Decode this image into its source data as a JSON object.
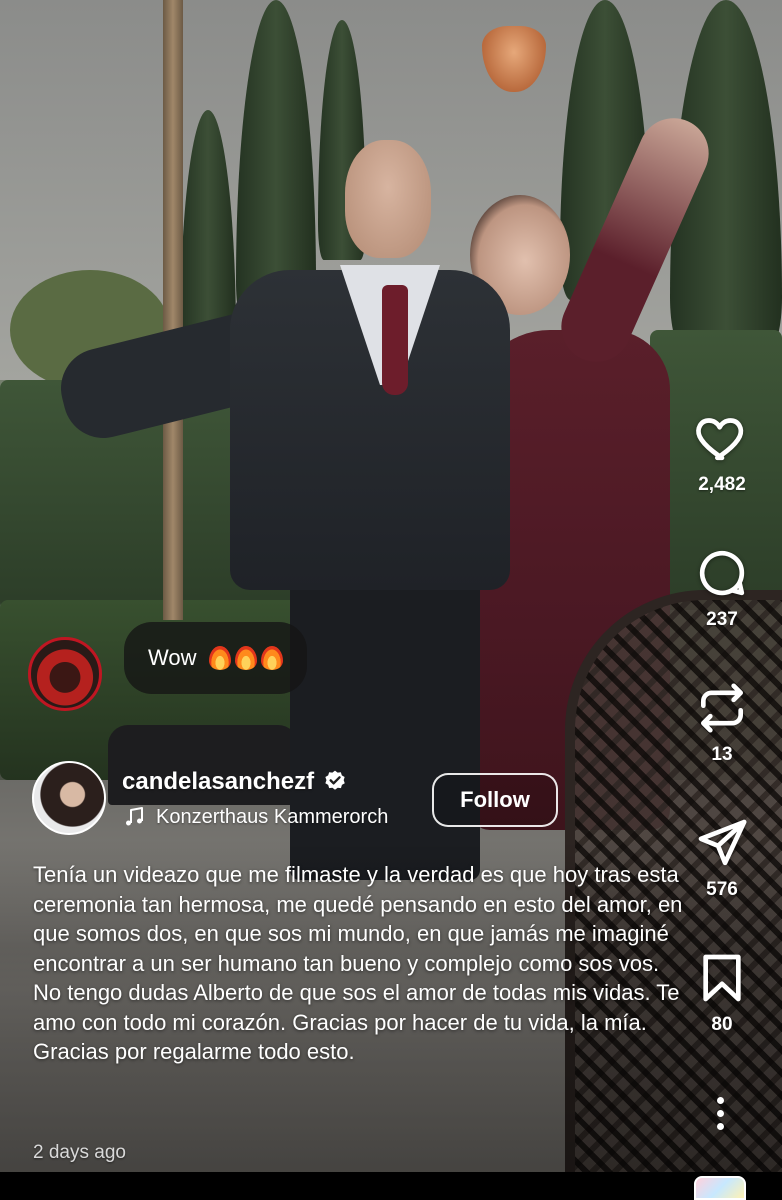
{
  "comment": {
    "text": "Wow",
    "emoji_count": 3,
    "emoji_icon": "fire-emoji"
  },
  "actions": {
    "likes": "2,482",
    "comments": "237",
    "reposts": "13",
    "shares": "576",
    "saves": "80"
  },
  "author": {
    "username": "candelasanchezf",
    "verified": true,
    "audio": "Konzerthaus Kammerorch",
    "follow_label": "Follow"
  },
  "post": {
    "caption": "Tenía un videazo que me filmaste y la verdad es que hoy tras esta ceremonia tan hermosa, me quedé pensando en esto del amor, en que somos dos, en que sos mi mundo, en que jamás me imaginé encontrar a un ser humano tan bueno y complejo como sos vos.\nNo tengo dudas Alberto de que sos el amor de todas mis vidas. Te amo con todo mi corazón. Gracias por hacer de tu vida, la mía. Gracias por regalarme todo esto.",
    "time_ago": "2 days ago"
  },
  "colors": {
    "icon": "#ffffff",
    "bubble_bg": "#141414",
    "follow_border": "#ffffff"
  }
}
